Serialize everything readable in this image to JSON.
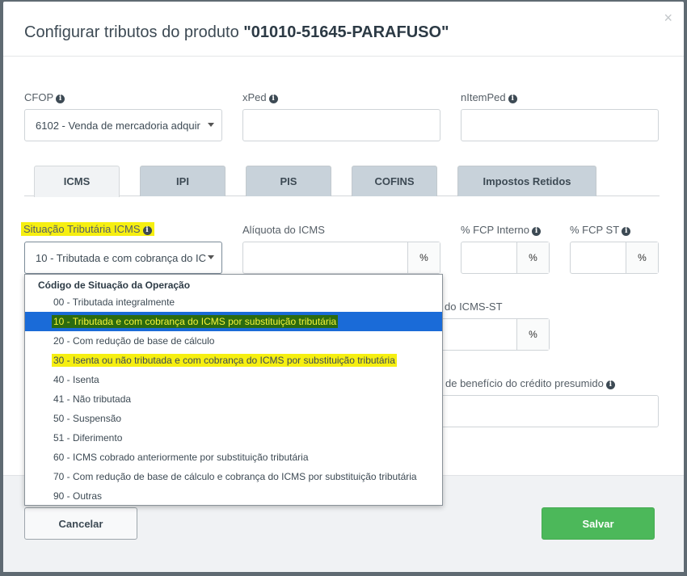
{
  "modal": {
    "title_prefix": "Configurar tributos do produto",
    "title_product": "\"01010-51645-PARAFUSO\"",
    "close_glyph": "×"
  },
  "fields": {
    "cfop": {
      "label": "CFOP",
      "value": "6102 - Venda de mercadoria adquir"
    },
    "xped": {
      "label": "xPed",
      "value": ""
    },
    "nitemped": {
      "label": "nItemPed",
      "value": ""
    }
  },
  "tabs": [
    {
      "label": "ICMS"
    },
    {
      "label": "IPI"
    },
    {
      "label": "PIS"
    },
    {
      "label": "COFINS"
    },
    {
      "label": "Impostos Retidos"
    }
  ],
  "icms": {
    "situacao_label": "Situação Tributária ICMS",
    "situacao_value": "10 - Tributada e com cobrança do ICMS",
    "aliquota_label": "Alíquota do ICMS",
    "fcp_interno_label": "% FCP Interno",
    "fcp_st_label": "% FCP ST",
    "icms_st_partial_label": "do ICMS-ST",
    "beneficio_partial_label": "de benefício do crédito presumido",
    "percent": "%"
  },
  "dropdown": {
    "header": "Código de Situação da Operação",
    "options": [
      "00 - Tributada integralmente",
      "10 - Tributada e com cobrança do ICMS por substituição tributária",
      "20 - Com redução de base de cálculo",
      "30 - Isenta ou não tributada e com cobrança do ICMS por substituição tributária",
      "40 - Isenta",
      "41 - Não tributada",
      "50 - Suspensão",
      "51 - Diferimento",
      "60 - ICMS cobrado anteriormente por substituição tributária",
      "70 - Com redução de base de cálculo e cobrança do ICMS por substituição tributária",
      "90 - Outras"
    ],
    "selected_index": 1,
    "highlighted_index": 3
  },
  "footer": {
    "cancel_label": "Cancelar",
    "save_label": "Salvar"
  },
  "colors": {
    "save_button": "#4cb85a",
    "selected_option": "#1a6bd8",
    "highlight": "#f6ef11",
    "overlay": "#5f6a72"
  }
}
